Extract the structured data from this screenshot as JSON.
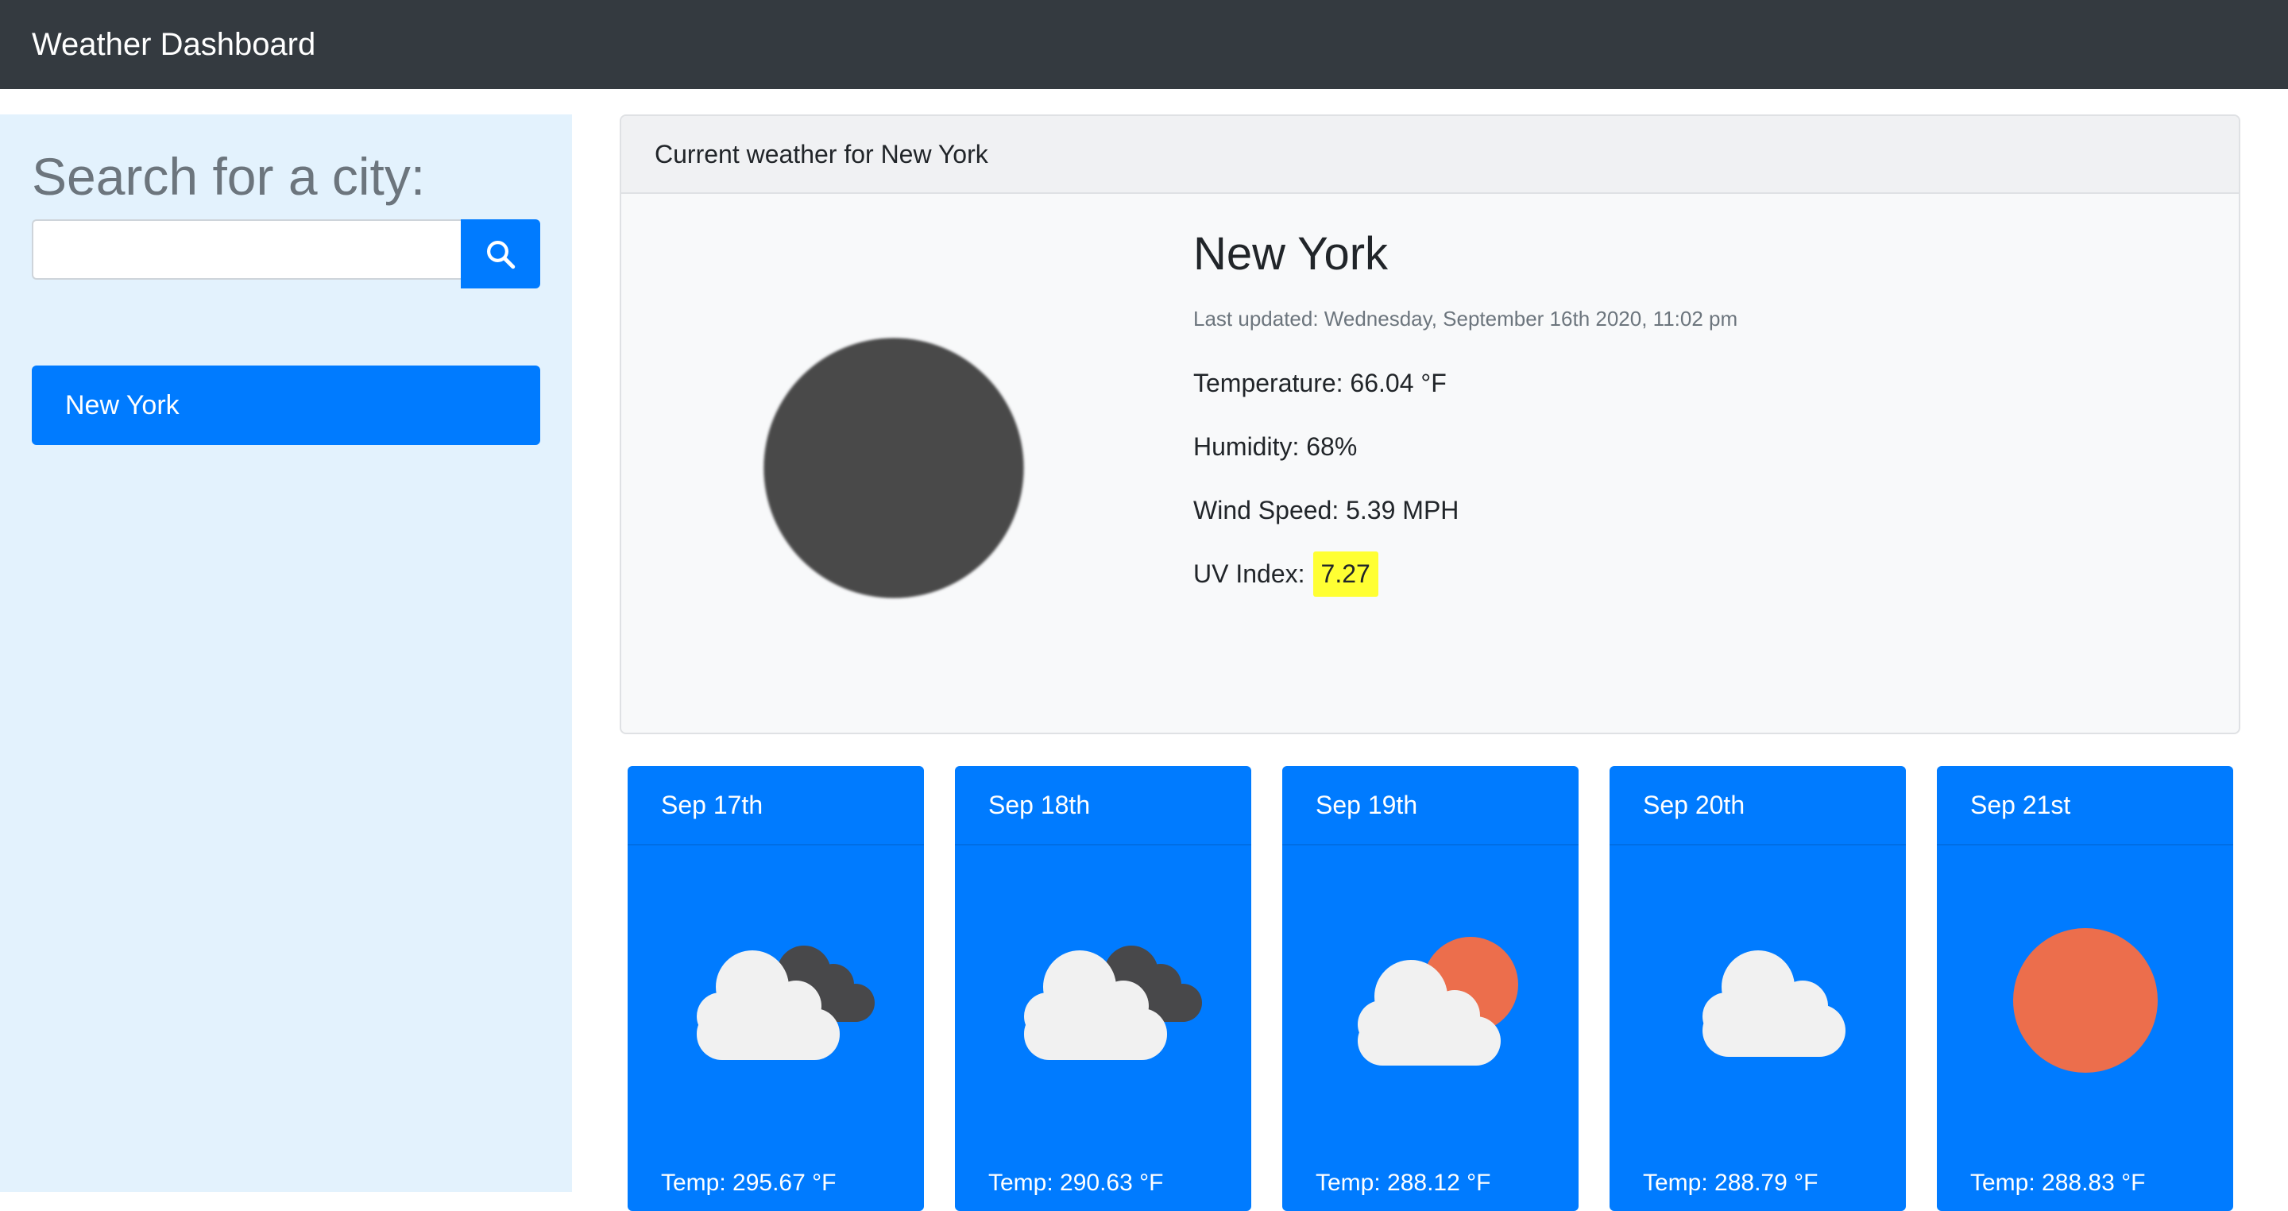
{
  "navbar": {
    "brand": "Weather Dashboard"
  },
  "sidebar": {
    "heading": "Search for a city:",
    "search": {
      "value": "",
      "placeholder": ""
    },
    "search_icon": "search-icon",
    "cities": [
      {
        "label": "New York"
      }
    ]
  },
  "current": {
    "header": "Current weather for New York",
    "icon": "dark-circle-icon",
    "city": "New York",
    "last_updated": "Last updated: Wednesday, September 16th 2020, 11:02 pm",
    "temperature": "Temperature: 66.04 °F",
    "humidity": "Humidity: 68%",
    "wind": "Wind Speed: 5.39 MPH",
    "uv_label": "UV Index:",
    "uv_value": "7.27"
  },
  "forecast": [
    {
      "date": "Sep 17th",
      "icon": "cloud-dark-cloud-icon",
      "temp": "Temp: 295.67 °F"
    },
    {
      "date": "Sep 18th",
      "icon": "cloud-dark-cloud-icon",
      "temp": "Temp: 290.63 °F"
    },
    {
      "date": "Sep 19th",
      "icon": "cloud-sun-icon",
      "temp": "Temp: 288.12 °F"
    },
    {
      "date": "Sep 20th",
      "icon": "cloud-icon",
      "temp": "Temp: 288.79 °F"
    },
    {
      "date": "Sep 21st",
      "icon": "sun-icon",
      "temp": "Temp: 288.83 °F"
    }
  ],
  "colors": {
    "navbar": "#343a40",
    "sidebar": "#e3f2fd",
    "primary": "#007bff",
    "uv_highlight": "#ffff33",
    "sun": "#ec6e4c",
    "dark_cloud": "#48484a",
    "cloud": "#f1f1f1"
  }
}
